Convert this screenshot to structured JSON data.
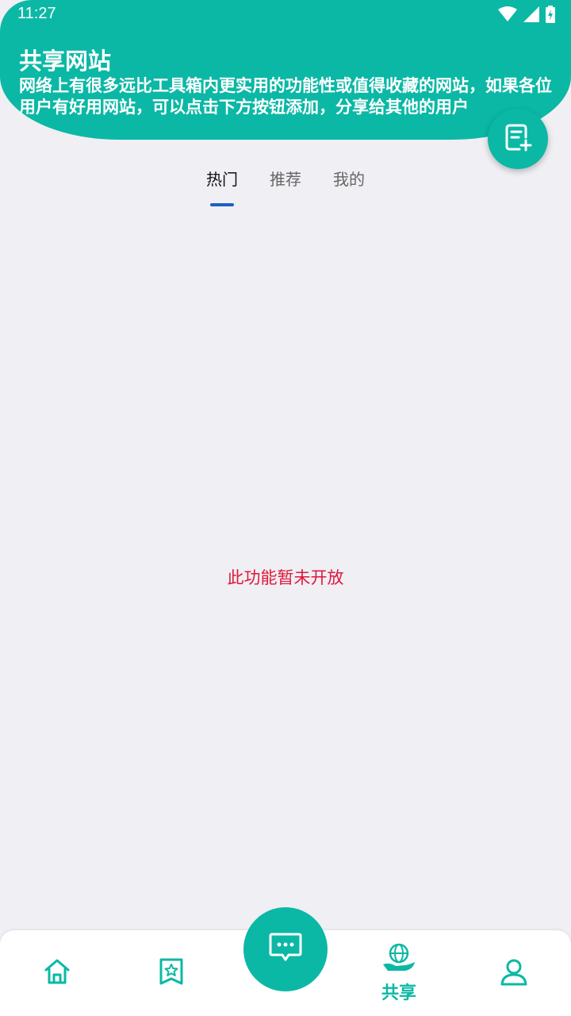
{
  "status_bar": {
    "time": "11:27"
  },
  "header": {
    "title": "共享网站",
    "description": "网络上有很多远比工具箱内更实用的功能性或值得收藏的网站，如果各位用户有好用网站，可以点击下方按钮添加，分享给其他的用户"
  },
  "tabs": [
    {
      "label": "热门",
      "active": true
    },
    {
      "label": "推荐",
      "active": false
    },
    {
      "label": "我的",
      "active": false
    }
  ],
  "main": {
    "empty_message": "此功能暂未开放"
  },
  "bottom_nav": {
    "items": [
      {
        "icon": "home-icon",
        "label": ""
      },
      {
        "icon": "star-bookmark-icon",
        "label": ""
      },
      {
        "icon": "chat-icon",
        "label": ""
      },
      {
        "icon": "globe-hand-icon",
        "label": "共享",
        "active": true
      },
      {
        "icon": "user-icon",
        "label": ""
      }
    ]
  },
  "colors": {
    "accent": "#0bb8a5",
    "tab_indicator": "#1b5fc4",
    "warning_text": "#e0173a",
    "background": "#efeff4"
  }
}
